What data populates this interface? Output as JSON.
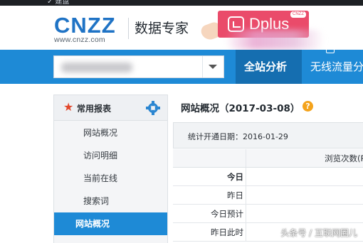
{
  "top_strip": {
    "glyph": "✓ 建盘"
  },
  "logo": {
    "mark": "CNZZ",
    "url": "www.cnzz.com"
  },
  "brand_tag": "数据专家",
  "overlay_badge": {
    "label": "Dplus",
    "tag": "CNZZ",
    "color": "#ea4b6a"
  },
  "site_selector": {
    "value": ""
  },
  "nav": {
    "tabs": [
      {
        "label": "全站分析",
        "active": true
      },
      {
        "label": "无线流量分"
      }
    ]
  },
  "sidebar": {
    "title": "常用报表",
    "items": [
      {
        "label": "网站概况"
      },
      {
        "label": "访问明细"
      },
      {
        "label": "当前在线"
      },
      {
        "label": "搜索词"
      },
      {
        "label": "网站概况",
        "active": true
      }
    ]
  },
  "main": {
    "page_title": "网站概况（2017-03-08）",
    "help_icon": "?",
    "info": "统计开通日期：2016-01-29",
    "table": {
      "column_header": "浏览次数(PV",
      "rows": [
        {
          "label": "今日",
          "bold": true
        },
        {
          "label": "昨日"
        },
        {
          "label": "今日预计"
        },
        {
          "label": "昨日此时"
        }
      ]
    }
  },
  "watermark": "头条号 / 互联网圈儿",
  "colors": {
    "brand_blue": "#1e8ad6",
    "active_tab": "#156eb0",
    "logo_blue": "#1f73c5",
    "star_red": "#e2472a",
    "help_orange": "#f4a31c"
  }
}
